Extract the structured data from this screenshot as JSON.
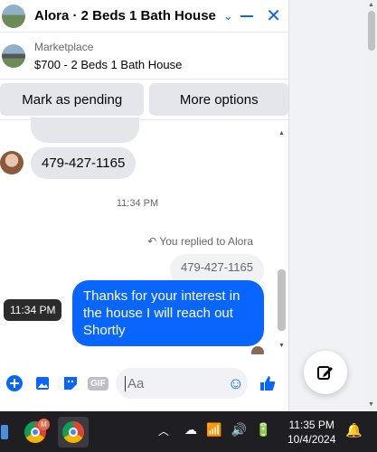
{
  "chat": {
    "title": "Alora · 2 Beds 1 Bath House",
    "listing_kind": "Marketplace",
    "listing_price": "$700 - 2 Beds 1 Bath House",
    "actions": {
      "pending": "Mark as pending",
      "more": "More options"
    }
  },
  "messages": {
    "incoming_phone": "479-427-1165",
    "time_divider": "11:34 PM",
    "reply_note": "You replied to Alora",
    "quoted_text": "479-427-1165",
    "outgoing_text": "Thanks for your interest in the house I will reach out Shortly",
    "tooltip_time": "11:34 PM"
  },
  "composer": {
    "placeholder": "Aa",
    "gif_label": "GIF"
  },
  "taskbar": {
    "mail_badge": "M",
    "time": "11:35 PM",
    "date": "10/4/2024"
  },
  "colors": {
    "messenger_blue": "#0866ff",
    "bubble_gray": "#e4e6eb"
  }
}
